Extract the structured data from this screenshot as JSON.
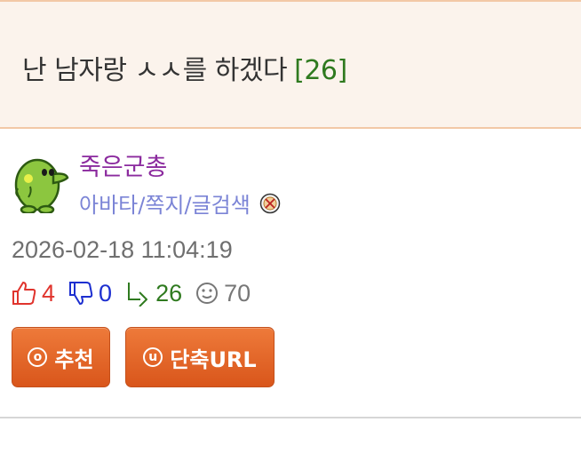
{
  "post": {
    "title": "난 남자랑 ㅅㅅ를 하겠다",
    "comment_count": "[26]"
  },
  "author": {
    "nickname": "죽은군총",
    "links": "아바타/쪽지/글검색",
    "avatar_icon": "green-creature-avatar",
    "extra_icon": "no-entry-icon"
  },
  "meta": {
    "timestamp": "2026-02-18 11:04:19"
  },
  "stats": {
    "upvotes": "4",
    "downvotes": "0",
    "replies": "26",
    "views": "70"
  },
  "buttons": {
    "recommend_label": "추천",
    "recommend_icon_glyph": "ⓞ",
    "shorturl_label": "단축URL",
    "shorturl_icon_glyph": "ⓤ"
  },
  "colors": {
    "title_bg": "#fbf3ec",
    "title_border": "#f2c8a6",
    "comment_count": "#2f7a1f",
    "nickname": "#8b2a9e",
    "links": "#7b84d6",
    "upvote": "#e0342d",
    "downvote": "#1d2fd0",
    "reply": "#2f7a1f",
    "button": "#e0651f"
  }
}
